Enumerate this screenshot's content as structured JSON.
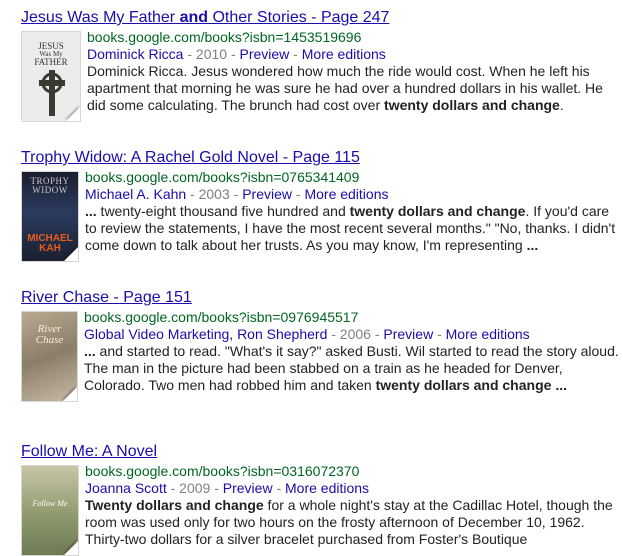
{
  "results": [
    {
      "title_pre": "Jesus Was My Father ",
      "title_bold": "and",
      "title_post": " Other Stories - Page 247",
      "url": "books.google.com/books?isbn=1453519696",
      "author": "Dominick Ricca",
      "year": " - 2010 - ",
      "preview": "Preview",
      "sep": " - ",
      "more": "More editions",
      "lead_ellipsis": "",
      "snippet_pre": "Dominick Ricca. Jesus wondered how much the ride would cost. When he left his apartment that morning he was sure he had over a hundred dollars in his wallet. He did some calculating. The brunch had cost over ",
      "snippet_bold": "twenty dollars and change",
      "snippet_post": ".",
      "trail_ellipsis": "",
      "cover_lines": [
        "JESUS",
        "Was My",
        "FATHER"
      ]
    },
    {
      "title": "Trophy Widow: A Rachel Gold Novel - Page 115",
      "url": "books.google.com/books?isbn=0765341409",
      "author": "Michael A. Kahn",
      "year": " - 2003 - ",
      "preview": "Preview",
      "sep": " - ",
      "more": "More editions",
      "lead_ellipsis": "...",
      "snippet_pre": " twenty-eight thousand five hundred and ",
      "snippet_bold": "twenty dollars and change",
      "snippet_post": ". If you'd care to review the statements, I have the most recent several months.\" \"No, thanks. I didn't come down to talk about her trusts. As you may know, I'm representing ",
      "trail_ellipsis": "...",
      "cover_lines": [
        "TROPHY",
        "WIDOW",
        "MICHAEL",
        "KAH"
      ]
    },
    {
      "title": "River Chase - Page 151",
      "url": "books.google.com/books?isbn=0976945517",
      "author": "Global Video Marketing",
      "author2": "Ron Shepherd",
      "year": " - 2006 - ",
      "preview": "Preview",
      "sep": " - ",
      "more": "More editions",
      "lead_ellipsis": "...",
      "snippet_pre": " and started to read. \"What's it say?\" asked Busti. Wil started to read the story aloud. The man in the picture had been stabbed on a train as he headed for Denver, Colorado. Two men had robbed him and taken ",
      "snippet_bold": "twenty dollars and change",
      "snippet_post": " ",
      "trail_ellipsis": "...",
      "cover_lines": [
        "River",
        "Chase"
      ]
    },
    {
      "title": "Follow Me: A Novel",
      "url": "books.google.com/books?isbn=0316072370",
      "author": "Joanna Scott",
      "year": " - 2009 - ",
      "preview": "Preview",
      "sep": " - ",
      "more": "More editions",
      "lead_ellipsis": "",
      "snippet_bold": "Twenty dollars and change",
      "snippet_post": " for a whole night's stay at the Cadillac Hotel, though the room was used only for two hours on the frosty afternoon of December 10, 1962. Thirty-two dollars for a silver bracelet purchased from Foster's Boutique",
      "trail_ellipsis": "",
      "cover_lines": [
        "Follow Me"
      ]
    }
  ]
}
